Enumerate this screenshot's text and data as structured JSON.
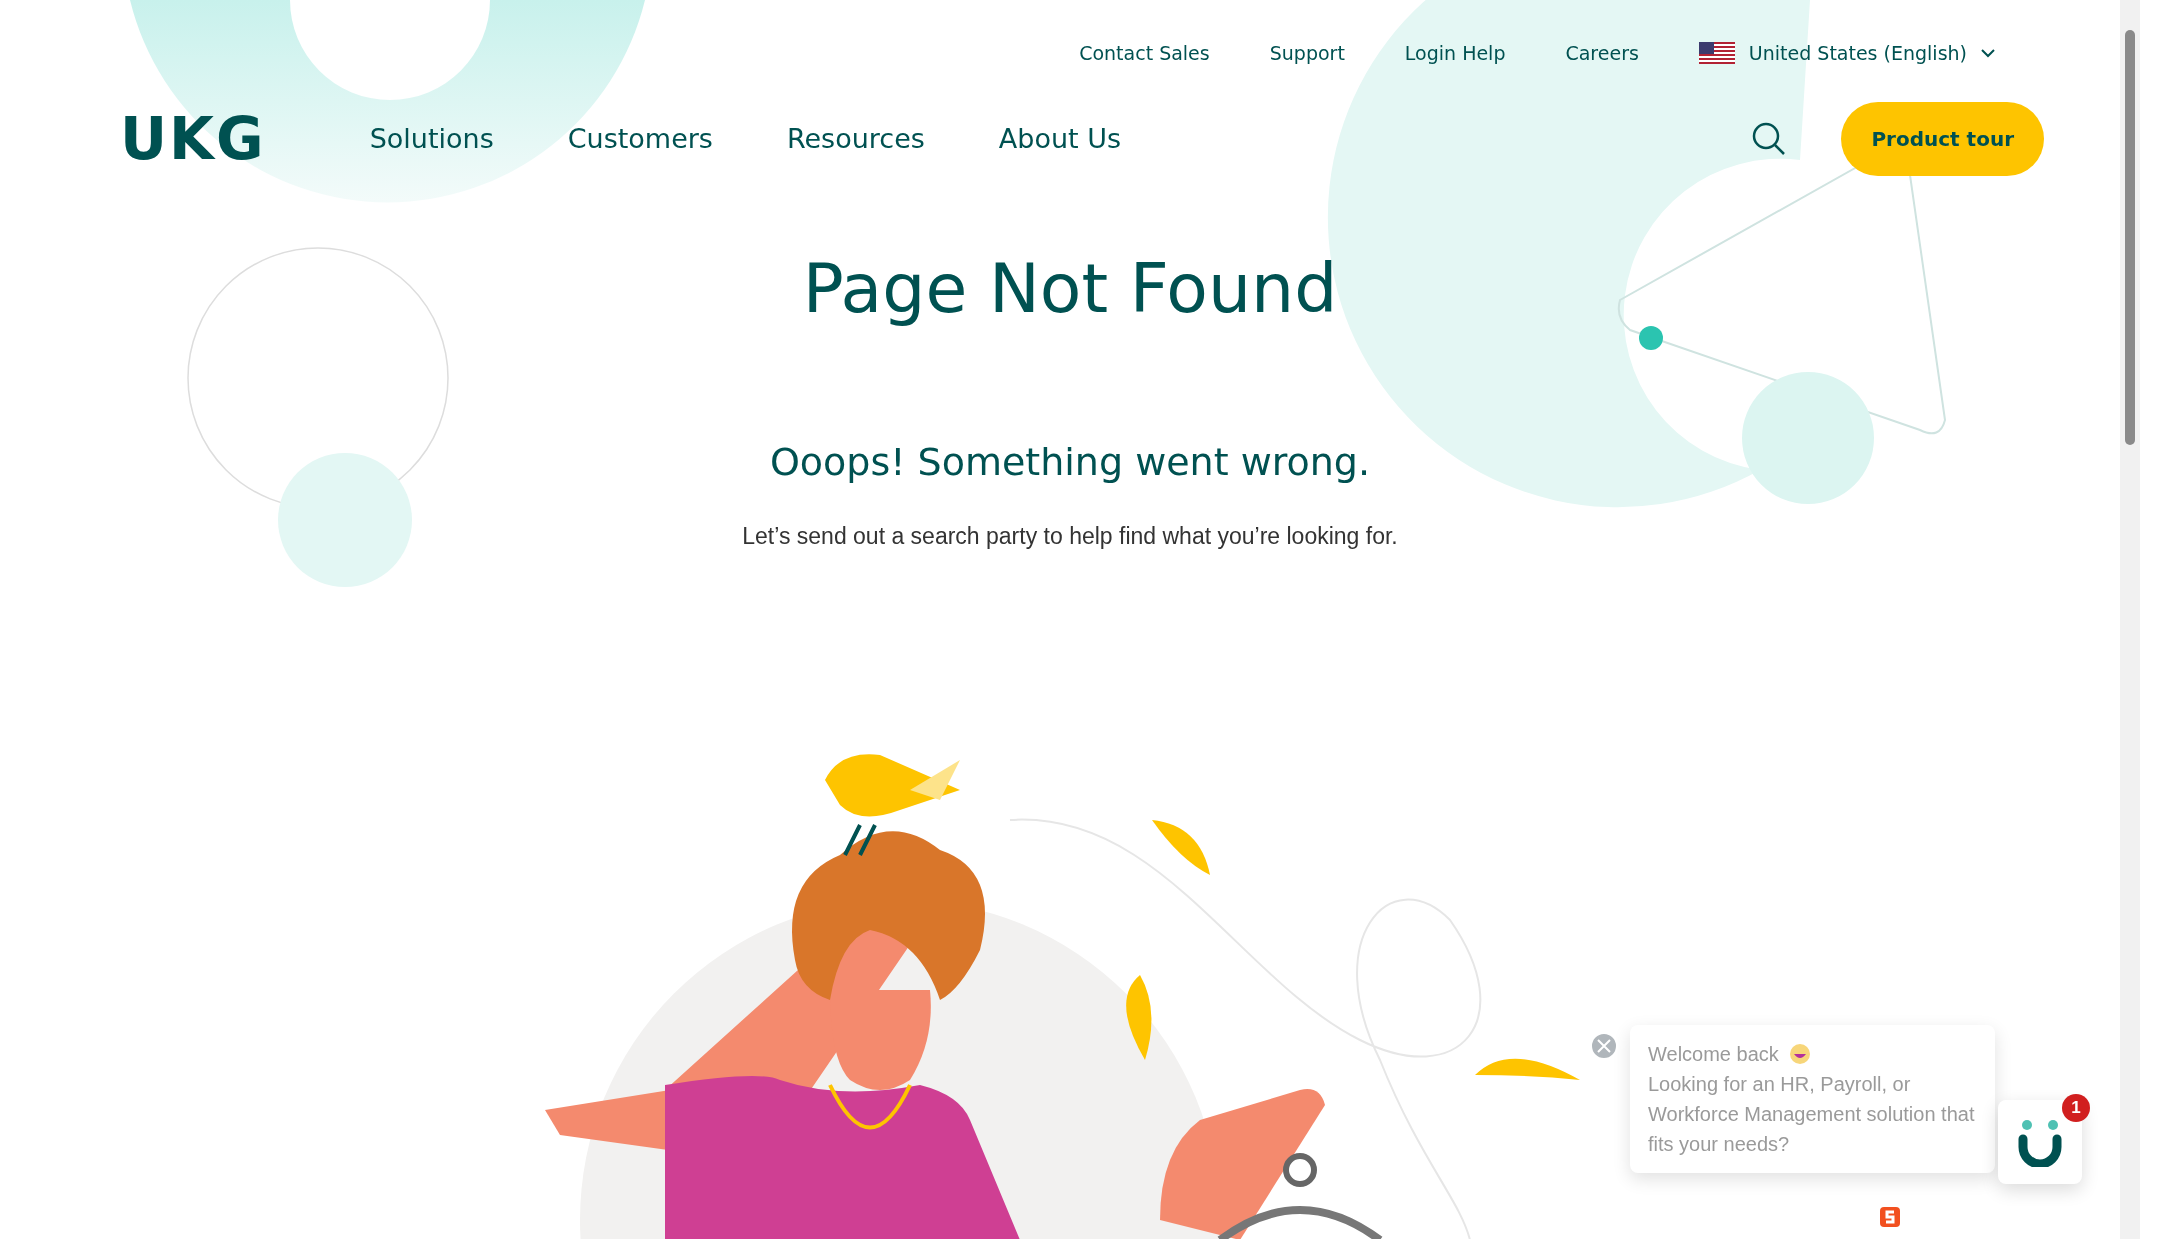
{
  "utility_links": [
    "Contact Sales",
    "Support",
    "Login Help",
    "Careers"
  ],
  "region": {
    "label": "United States (English)"
  },
  "logo": "UKG",
  "nav": [
    "Solutions",
    "Customers",
    "Resources",
    "About Us"
  ],
  "cta": "Product tour",
  "heading": "Page Not Found",
  "subheading": "Ooops! Something went wrong.",
  "message": "Let’s send out a search party to help find what you’re looking for.",
  "chat": {
    "greeting": "Welcome back",
    "message": "Looking for an HR, Payroll, or Workforce Management solution that fits your needs?",
    "badge": "1"
  }
}
